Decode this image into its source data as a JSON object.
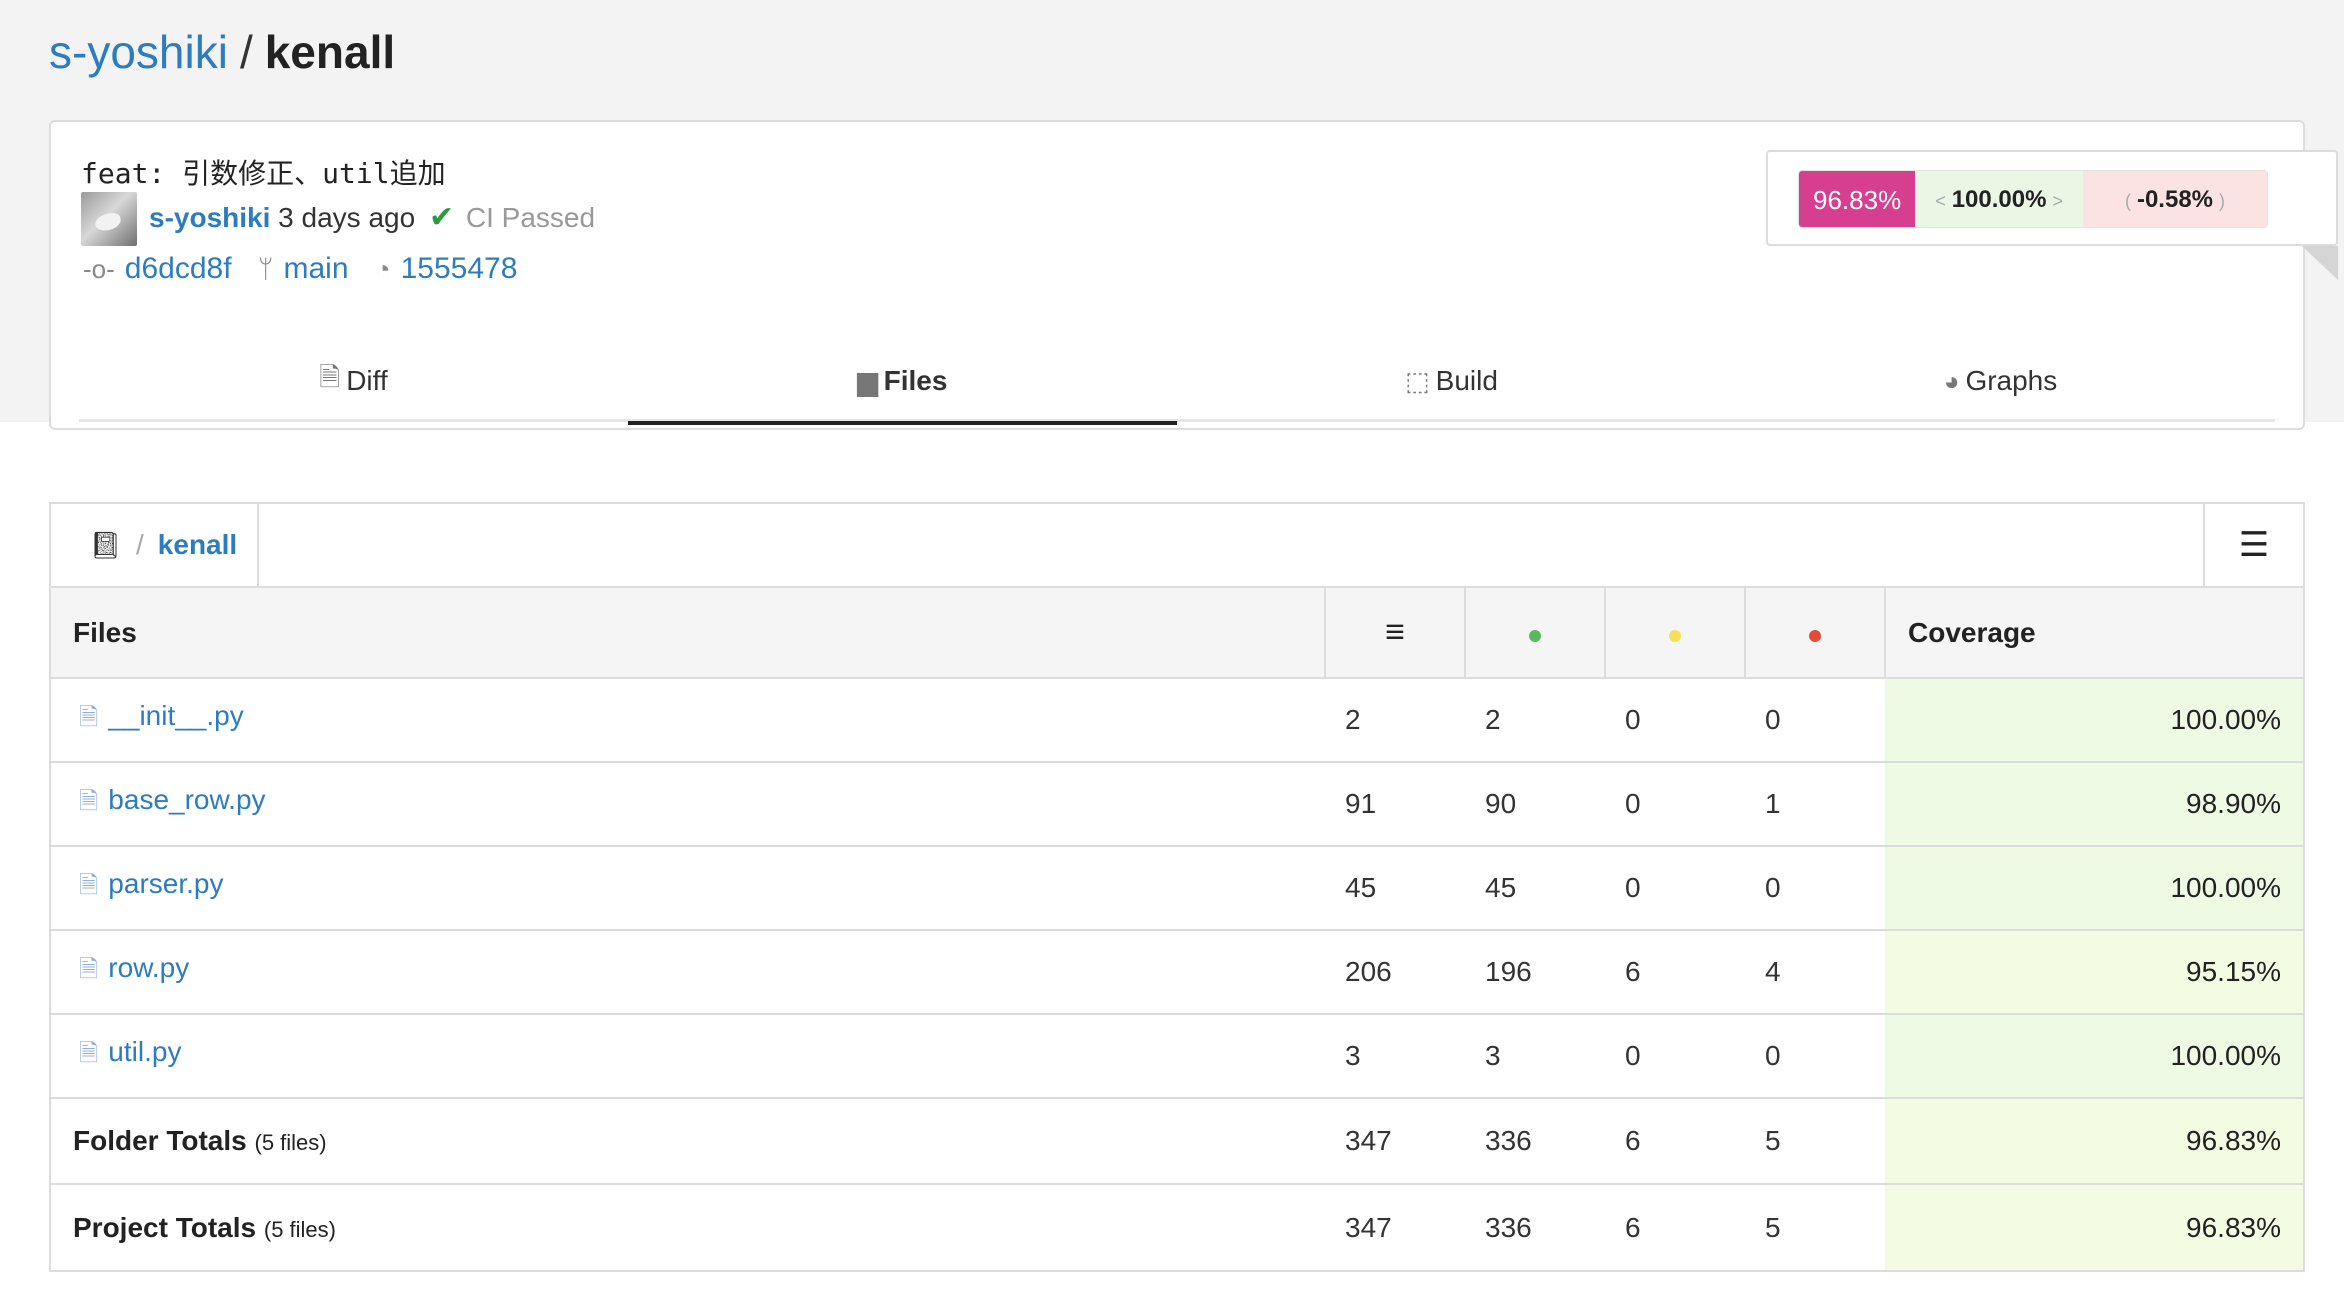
{
  "repo": {
    "owner": "s-yoshiki",
    "separator": "/",
    "name": "kenall"
  },
  "commit": {
    "message": "feat: 引数修正、util追加",
    "author": "s-yoshiki",
    "time_ago": "3 days ago",
    "ci_status": "CI Passed",
    "sha": "d6dcd8f",
    "branch": "main",
    "build_id": "1555478"
  },
  "coverage": {
    "current": "96.83%",
    "head": "100.00%",
    "diff": "-0.58%",
    "colors": {
      "current": "#d63e90",
      "head": "#e9f7e4",
      "diff": "#fbe3e4"
    }
  },
  "tabs": [
    {
      "label": "Diff",
      "icon": "file-diff-icon"
    },
    {
      "label": "Files",
      "icon": "folder-icon",
      "active": true
    },
    {
      "label": "Build",
      "icon": "box-icon"
    },
    {
      "label": "Graphs",
      "icon": "pie-chart-icon"
    }
  ],
  "breadcrumb": {
    "root_icon": "book-icon",
    "separator": "/",
    "dir": "kenall"
  },
  "table": {
    "headers": {
      "files": "Files",
      "lines": "≡",
      "coverage": "Coverage"
    },
    "dot_colors": {
      "hit": "#5cb85c",
      "partial": "#f5e05a",
      "miss": "#e04b3c"
    },
    "rows": [
      {
        "name": "__init__.py",
        "lines": "2",
        "hits": "2",
        "partials": "0",
        "misses": "0",
        "coverage": "100.00%"
      },
      {
        "name": "base_row.py",
        "lines": "91",
        "hits": "90",
        "partials": "0",
        "misses": "1",
        "coverage": "98.90%"
      },
      {
        "name": "parser.py",
        "lines": "45",
        "hits": "45",
        "partials": "0",
        "misses": "0",
        "coverage": "100.00%"
      },
      {
        "name": "row.py",
        "lines": "206",
        "hits": "196",
        "partials": "6",
        "misses": "4",
        "coverage": "95.15%"
      },
      {
        "name": "util.py",
        "lines": "3",
        "hits": "3",
        "partials": "0",
        "misses": "0",
        "coverage": "100.00%"
      }
    ],
    "totals": [
      {
        "label": "Folder Totals",
        "note": "(5 files)",
        "lines": "347",
        "hits": "336",
        "partials": "6",
        "misses": "5",
        "coverage": "96.83%"
      },
      {
        "label": "Project Totals",
        "note": "(5 files)",
        "lines": "347",
        "hits": "336",
        "partials": "6",
        "misses": "5",
        "coverage": "96.83%"
      }
    ]
  }
}
